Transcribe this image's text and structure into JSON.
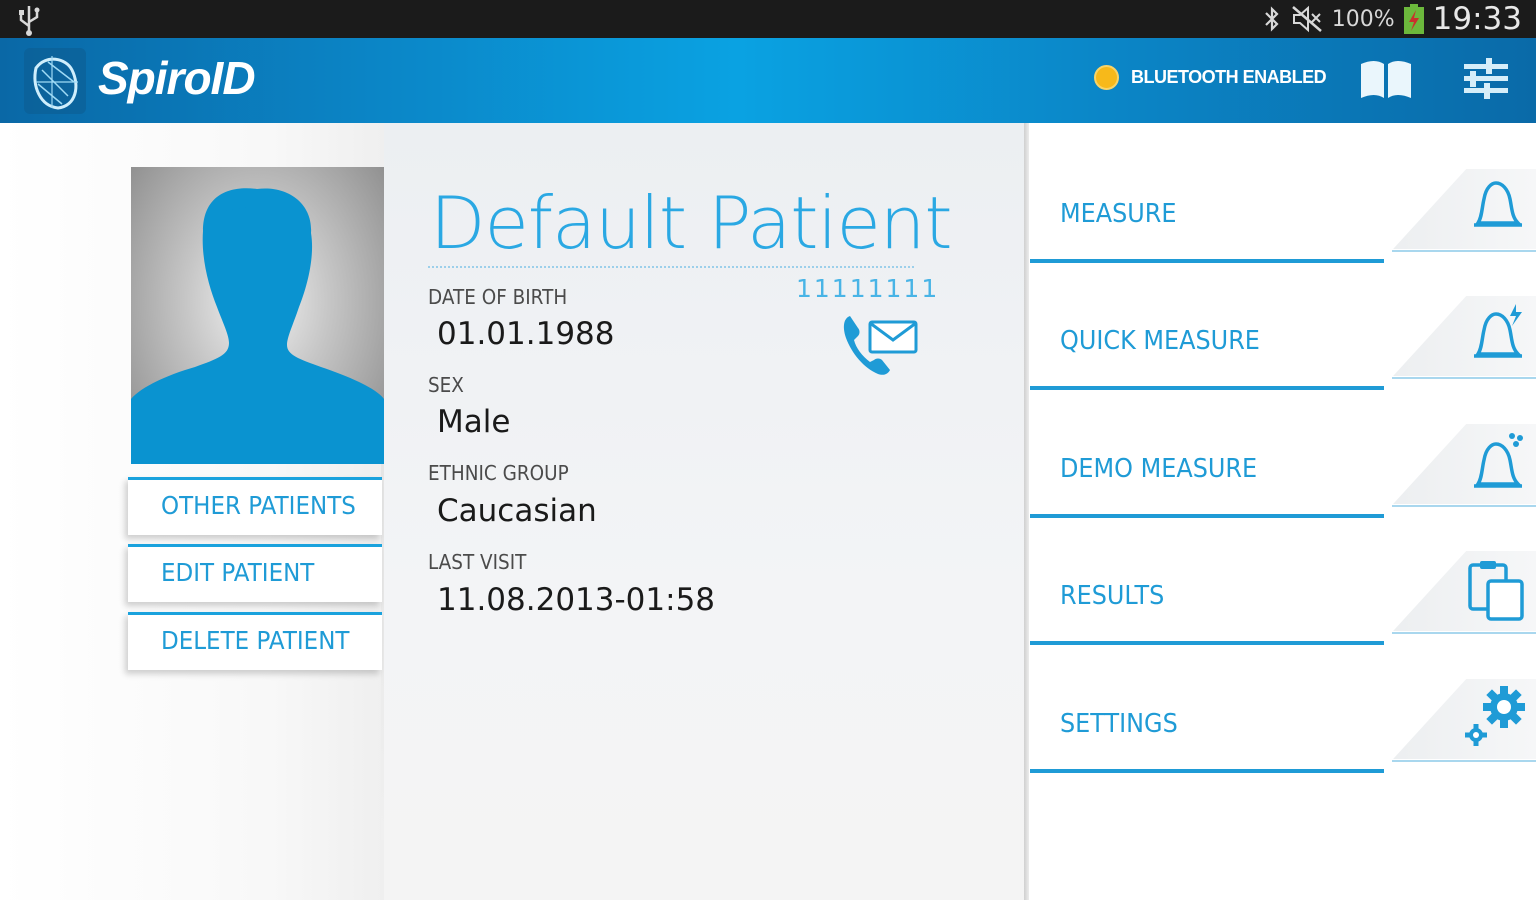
{
  "status_bar": {
    "battery_percent": "100%",
    "time": "19:33",
    "icons": [
      "usb-icon",
      "bluetooth-icon",
      "muted-icon",
      "battery-charging-icon"
    ]
  },
  "app_bar": {
    "title": "SpiroID",
    "bluetooth_status": "BLUETOOTH ENABLED",
    "bluetooth_dot_color": "#f7b91a",
    "icons": [
      "logo-icon",
      "book-icon",
      "sliders-icon"
    ]
  },
  "patient": {
    "name": "Default Patient",
    "id": "11111111",
    "fields": [
      {
        "label": "DATE OF BIRTH",
        "value": "01.01.1988"
      },
      {
        "label": "SEX",
        "value": "Male"
      },
      {
        "label": "ETHNIC GROUP",
        "value": "Caucasian"
      },
      {
        "label": "LAST VISIT",
        "value": "11.08.2013-01:58"
      }
    ]
  },
  "side_actions": [
    {
      "label": "OTHER PATIENTS"
    },
    {
      "label": "EDIT PATIENT"
    },
    {
      "label": "DELETE PATIENT"
    }
  ],
  "menu": [
    {
      "label": "MEASURE",
      "icon": "bell-icon"
    },
    {
      "label": "QUICK MEASURE",
      "icon": "bell-lightning-icon"
    },
    {
      "label": "DEMO MEASURE",
      "icon": "bell-demo-icon"
    },
    {
      "label": "RESULTS",
      "icon": "clipboard-icon"
    },
    {
      "label": "SETTINGS",
      "icon": "gears-icon"
    }
  ],
  "colors": {
    "accent": "#1f9bd6",
    "app_bar": "#0b86c7",
    "status_bar": "#1b1b1b"
  }
}
